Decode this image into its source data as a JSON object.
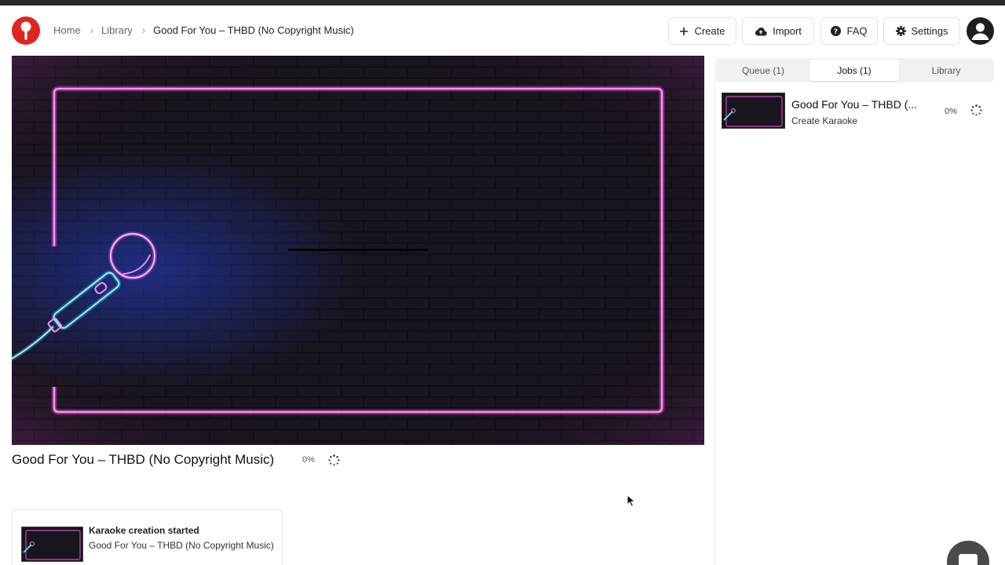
{
  "breadcrumb": {
    "home": "Home",
    "library": "Library",
    "current": "Good For You – THBD (No Copyright Music)"
  },
  "toolbar": {
    "create_label": "Create",
    "import_label": "Import",
    "faq_label": "FAQ",
    "settings_label": "Settings"
  },
  "main": {
    "song_title": "Good For You – THBD (No Copyright Music)",
    "progress_label": "0%"
  },
  "toast": {
    "title": "Karaoke creation started",
    "subtitle": "Good For You – THBD (No Copyright Music)"
  },
  "sidebar": {
    "tabs": [
      {
        "label": "Queue (1)",
        "active": false
      },
      {
        "label": "Jobs (1)",
        "active": true
      },
      {
        "label": "Library",
        "active": false
      }
    ],
    "jobs": [
      {
        "title": "Good For You – THBD (...",
        "subtitle": "Create Karaoke",
        "progress_label": "0%"
      }
    ]
  },
  "colors": {
    "brand": "#e0241f",
    "neon_pink": "#ff4fe8",
    "neon_cyan": "#3ff0ff",
    "background_dark": "#15131c"
  },
  "icons": {
    "logo": "microphone-logo-icon",
    "create": "plus-icon",
    "import": "cloud-upload-icon",
    "faq": "question-circle-icon",
    "settings": "gear-icon",
    "avatar": "user-avatar-icon",
    "progress": "spinner-icon",
    "chat": "chat-icon"
  }
}
